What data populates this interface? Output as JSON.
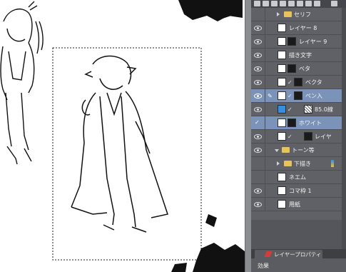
{
  "layers": [
    {
      "name": "セリフ",
      "kind": "folder"
    },
    {
      "name": "レイヤー 8",
      "kind": "raster"
    },
    {
      "name": "レイヤー 9",
      "kind": "raster"
    },
    {
      "name": "描き文字",
      "kind": "raster"
    },
    {
      "name": "ベタ",
      "kind": "raster"
    },
    {
      "name": "ベクタ",
      "kind": "vector"
    },
    {
      "name": "ペン入",
      "kind": "vector"
    },
    {
      "name": "85.0線",
      "kind": "tone"
    },
    {
      "name": "ホワイト",
      "kind": "raster"
    },
    {
      "name": "レイヤ",
      "kind": "raster"
    },
    {
      "name": "トーン等",
      "kind": "folder"
    },
    {
      "name": "下描き",
      "kind": "folder"
    },
    {
      "name": "ネエム",
      "kind": "raster"
    },
    {
      "name": "コマ枠 1",
      "kind": "raster"
    },
    {
      "name": "用紙",
      "kind": "paper"
    }
  ],
  "property_tab": {
    "label": "レイヤープロパティ"
  },
  "property_panel": {
    "effect_label": "効果"
  },
  "colors": {
    "panel_bg": "#5f6166",
    "selected_row": "#7b93b8",
    "folder": "#e8c35a"
  }
}
